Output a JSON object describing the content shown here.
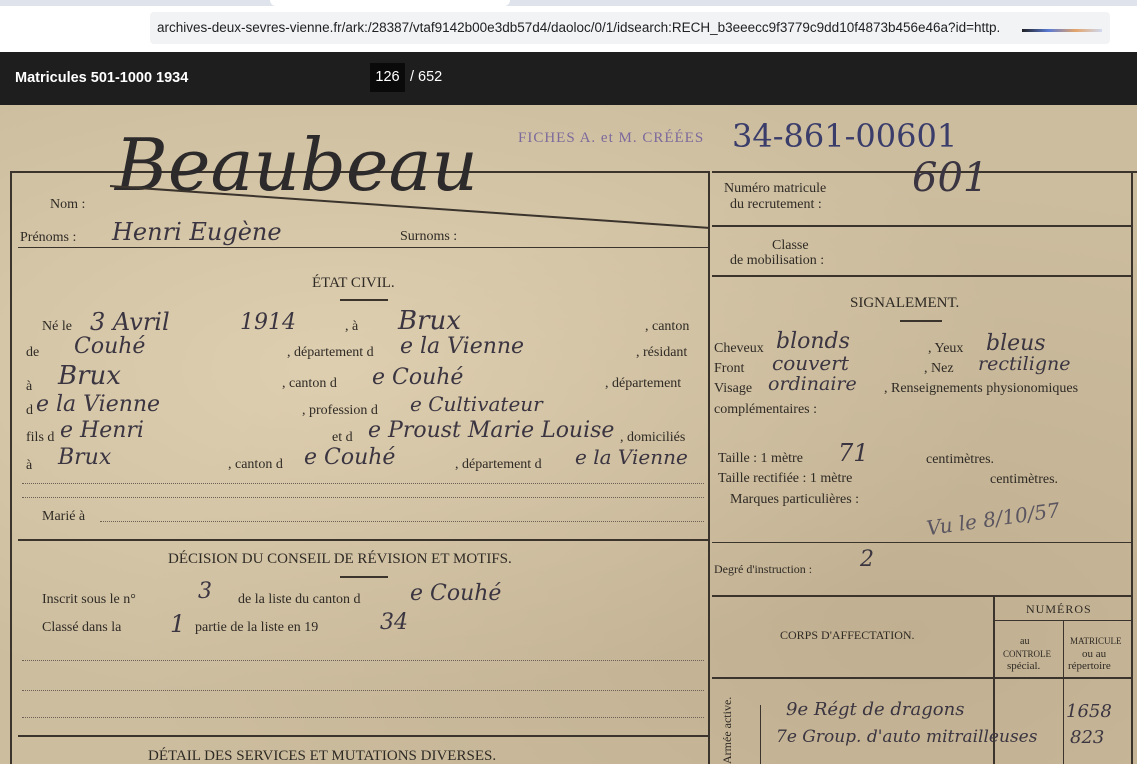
{
  "browser": {
    "url": "archives-deux-sevres-vienne.fr/ark:/28387/vtaf9142b00e3db57d4/daoloc/0/1/idsearch:RECH_b3eeecc9f3779c9dd10f4873b456e46a?id=http."
  },
  "viewer": {
    "title": "Matricules 501-1000 1934",
    "current_page": "126",
    "total_pages": "/ 652"
  },
  "document": {
    "stamp": "FICHES A. et M. CRÉÉES",
    "stamp_number": "34-861-00601",
    "surname_hand": "Beaubeau",
    "labels": {
      "nom": "Nom :",
      "prenoms": "Prénoms :",
      "surnoms": "Surnoms :",
      "etat_civil": "ÉTAT CIVIL.",
      "ne_le": "Né le",
      "a": ", à",
      "canton": ", canton",
      "de": "de",
      "departement_de": ", département d",
      "resident": ", résidant",
      "a2": "à",
      "canton_de": ", canton d",
      "departement": ", département",
      "d": "d",
      "profession_de": ", profession d",
      "fils_de": "fils d",
      "et_de": "et d",
      "domicilies": ", domiciliés",
      "a3": "à",
      "canton_de2": ", canton d",
      "departement_de2": ", département d",
      "marie_a": "Marié à",
      "decision": "DÉCISION DU CONSEIL DE RÉVISION ET MOTIFS.",
      "inscrit": "Inscrit sous le n°",
      "de_la_liste": "de la liste du canton d",
      "classe_dans": "Classé dans la",
      "partie": "partie de la liste en 19",
      "detail": "DÉTAIL DES SERVICES ET MUTATIONS DIVERSES.",
      "numero_matricule": "Numéro matricule",
      "du_recrutement": "du recrutement :",
      "classe": "Classe",
      "de_mobilisation": "de mobilisation :",
      "signalement": "SIGNALEMENT.",
      "cheveux": "Cheveux",
      "yeux": ", Yeux",
      "front": "Front",
      "nez": ", Nez",
      "visage": "Visage",
      "renseignements": ", Renseignements physionomiques",
      "complementaires": "complémentaires :",
      "taille": "Taille : 1 mètre",
      "centimetres": "centimètres.",
      "taille_rectifiee": "Taille rectifiée : 1 mètre",
      "centimetres2": "centimètres.",
      "marques": "Marques particulières :",
      "degre": "Degré d'instruction :",
      "numeros": "NUMÉROS",
      "corps": "CORPS D'AFFECTATION.",
      "au_controle": "au",
      "controle": "CONTROLE",
      "special": "spécial.",
      "matricule_col": "MATRICULE",
      "ou_au": "ou au",
      "repertoire": "répertoire",
      "armee_active": "Armée active."
    },
    "handwritten": {
      "prenoms": "Henri Eugène",
      "date_naissance": "3 Avril",
      "annee": "1914",
      "lieu": "Brux",
      "canton": "Couhé",
      "departement": "e la Vienne",
      "residant_a": "Brux",
      "canton_res": "e Couhé",
      "dept_res": "e la Vienne",
      "profession": "e Cultivateur",
      "pere": "e Henri",
      "mere": "e Proust Marie Louise",
      "domicile": "Brux",
      "canton_dom": "e Couhé",
      "dept_dom": "e la Vienne",
      "numero_matricule": "601",
      "cheveux": "blonds",
      "yeux": "bleus",
      "front": "couvert",
      "nez": "rectiligne",
      "visage": "ordinaire",
      "taille_cm": "71",
      "vu_le": "Vu le 8/10/57",
      "degre": "2",
      "inscrit_no": "3",
      "canton_liste": "e Couhé",
      "partie_no": "1",
      "annee_liste": "34",
      "corps1": "9e Régt de dragons",
      "corps1_num": "1658",
      "corps2": "7e Group. d'auto mitrailleuses",
      "corps2_num": "823"
    }
  }
}
